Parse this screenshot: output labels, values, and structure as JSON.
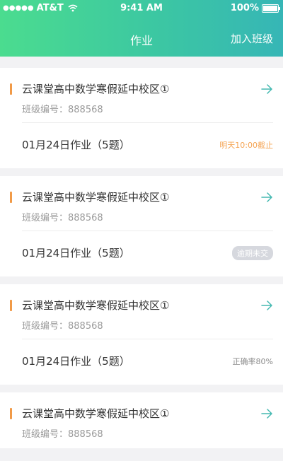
{
  "status_bar": {
    "signal": "●●●●●",
    "carrier": "AT&T",
    "time": "9:41 AM",
    "battery": "100%"
  },
  "nav": {
    "title": "作业",
    "action": "加入班级"
  },
  "colors": {
    "accent_bar": "#f19a47",
    "header_start": "#4bdc8f",
    "header_end": "#36b6b6",
    "arrow": "#45b9b1",
    "deadline": "#f5a453"
  },
  "cards": [
    {
      "class_name": "云课堂高中数学寒假延中校区①",
      "class_code": "班级编号：888568",
      "homework": "01月24日作业（5题）",
      "status": "明天10:00截止"
    },
    {
      "class_name": "云课堂高中数学寒假延中校区①",
      "class_code": "班级编号：888568",
      "homework": "01月24日作业（5题）",
      "status": "逾期未交"
    },
    {
      "class_name": "云课堂高中数学寒假延中校区①",
      "class_code": "班级编号：888568",
      "homework": "01月24日作业（5题）",
      "status": "正确率80%"
    },
    {
      "class_name": "云课堂高中数学寒假延中校区①",
      "class_code": "班级编号：888568"
    }
  ]
}
